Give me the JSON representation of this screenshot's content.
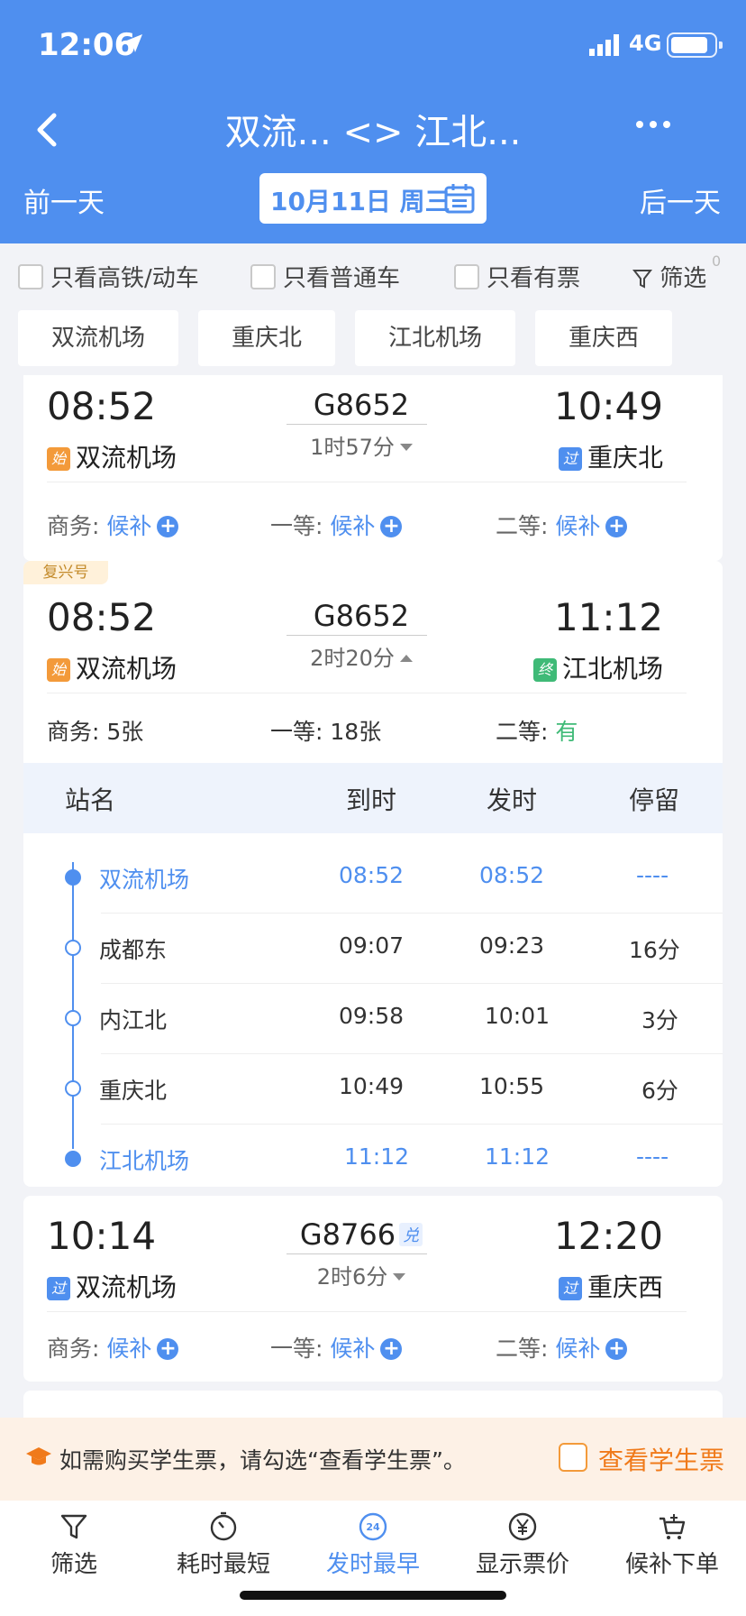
{
  "status": {
    "time": "12:06",
    "network": "4G"
  },
  "nav": {
    "title": "双流... <> 江北...",
    "prev_day": "前一天",
    "next_day": "后一天",
    "date": "10月11日  周三"
  },
  "filters": {
    "high_speed": "只看高铁/动车",
    "normal": "只看普通车",
    "available": "只看有票",
    "filter": "筛选",
    "filter_count": "0"
  },
  "stations": [
    "双流机场",
    "重庆北",
    "江北机场",
    "重庆西"
  ],
  "trains": [
    {
      "dep_time": "08:52",
      "arr_time": "10:49",
      "train_no": "G8652",
      "duration": "1时57分",
      "dep_badge": "始",
      "dep_station": "双流机场",
      "arr_badge": "过",
      "arr_station": "重庆北",
      "seats": [
        {
          "label": "商务:",
          "value": "候补"
        },
        {
          "label": "一等:",
          "value": "候补"
        },
        {
          "label": "二等:",
          "value": "候补"
        }
      ]
    },
    {
      "tag": "复兴号",
      "dep_time": "08:52",
      "arr_time": "11:12",
      "train_no": "G8652",
      "duration": "2时20分",
      "dep_badge": "始",
      "dep_station": "双流机场",
      "arr_badge": "终",
      "arr_station": "江北机场",
      "seats": [
        {
          "label": "商务:",
          "value": "5张"
        },
        {
          "label": "一等:",
          "value": "18张"
        },
        {
          "label": "二等:",
          "value": "有"
        }
      ],
      "schedule_header": [
        "站名",
        "到时",
        "发时",
        "停留"
      ],
      "schedule": [
        {
          "station": "双流机场",
          "arrive": "08:52",
          "depart": "08:52",
          "stay": "----"
        },
        {
          "station": "成都东",
          "arrive": "09:07",
          "depart": "09:23",
          "stay": "16分"
        },
        {
          "station": "内江北",
          "arrive": "09:58",
          "depart": "10:01",
          "stay": "3分"
        },
        {
          "station": "重庆北",
          "arrive": "10:49",
          "depart": "10:55",
          "stay": "6分"
        },
        {
          "station": "江北机场",
          "arrive": "11:12",
          "depart": "11:12",
          "stay": "----"
        }
      ]
    },
    {
      "dep_time": "10:14",
      "arr_time": "12:20",
      "train_no": "G8766",
      "train_badge": "兑",
      "duration": "2时6分",
      "dep_badge": "过",
      "dep_station": "双流机场",
      "arr_badge": "过",
      "arr_station": "重庆西",
      "seats": [
        {
          "label": "商务:",
          "value": "候补"
        },
        {
          "label": "一等:",
          "value": "候补"
        },
        {
          "label": "二等:",
          "value": "候补"
        }
      ]
    }
  ],
  "student": {
    "text": "如需购买学生票，请勾选“查看学生票”。",
    "label": "查看学生票"
  },
  "tabbar": {
    "filter": "筛选",
    "shortest": "耗时最短",
    "earliest": "发时最早",
    "earliest_badge": "24",
    "price": "显示票价",
    "waitlist": "候补下单"
  },
  "colors": {
    "primary": "#4f8fef",
    "orange": "#f07a1a",
    "green": "#3fba77"
  }
}
